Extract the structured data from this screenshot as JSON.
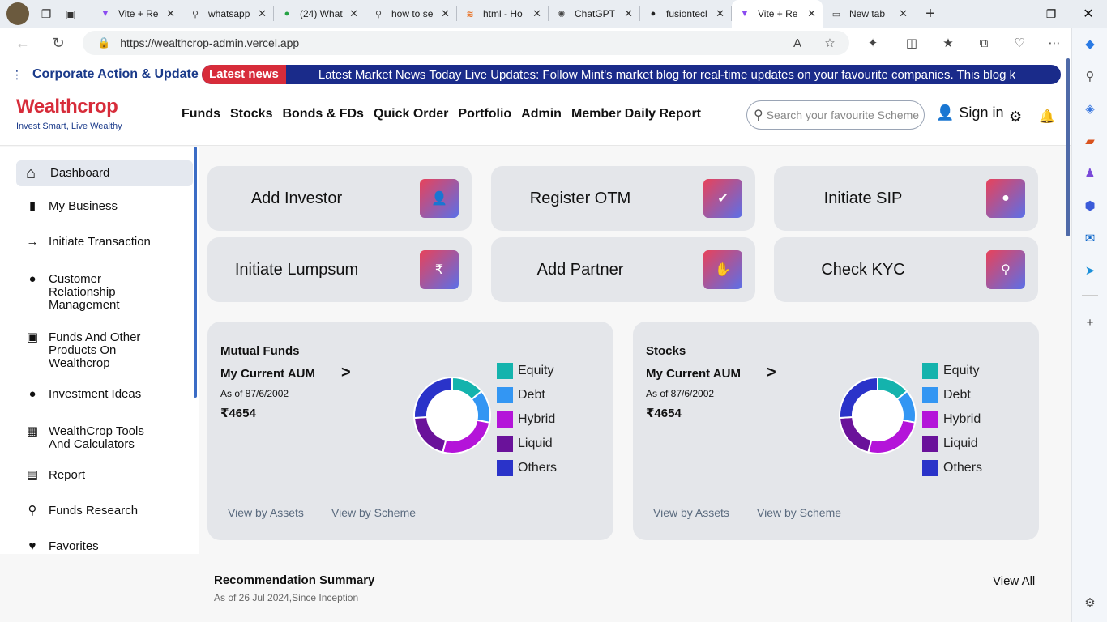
{
  "browser": {
    "tabs": [
      {
        "label": "Vite + Re",
        "icon": "vite-icon"
      },
      {
        "label": "whatsapp",
        "icon": "search-icon"
      },
      {
        "label": "(24) What",
        "icon": "whatsapp-icon"
      },
      {
        "label": "how to se",
        "icon": "search-icon"
      },
      {
        "label": "html - Ho",
        "icon": "stackoverflow-icon"
      },
      {
        "label": "ChatGPT",
        "icon": "chatgpt-icon"
      },
      {
        "label": "fusiontecl",
        "icon": "github-icon"
      },
      {
        "label": "Vite + Re",
        "icon": "vite-icon",
        "active": true
      },
      {
        "label": "New tab",
        "icon": "newtab-icon"
      }
    ],
    "url": "https://wealthcrop-admin.vercel.app"
  },
  "ticker": {
    "title": "Corporate Action & Update",
    "badge": "Latest news",
    "message": "Latest Market News Today Live Updates: Follow Mint's market blog for real-time updates on your favourite companies. This blog k"
  },
  "header": {
    "logo_text": "Wealthcrop",
    "tagline": "Invest Smart, Live Wealthy",
    "menu": [
      "Funds",
      "Stocks",
      "Bonds & FDs",
      "Quick Order",
      "Portfolio",
      "Admin",
      "Member Daily Report"
    ],
    "search_placeholder": "Search your favourite Scheme",
    "signin": "Sign in"
  },
  "sidebar": {
    "items": [
      {
        "label": "Dashboard",
        "icon": "home-icon",
        "active": true
      },
      {
        "label": "My Business",
        "icon": "briefcase-icon"
      },
      {
        "label": "Initiate Transaction",
        "icon": "arrow-right-icon"
      },
      {
        "label": "Customer Relationship Management",
        "icon": "user-icon"
      },
      {
        "label": "Funds And Other Products On Wealthcrop",
        "icon": "wallet-icon"
      },
      {
        "label": "Investment Ideas",
        "icon": "bulb-icon"
      },
      {
        "label": "WealthCrop Tools And Calculators",
        "icon": "calculator-icon"
      },
      {
        "label": "Report",
        "icon": "document-icon"
      },
      {
        "label": "Funds Research",
        "icon": "search-icon"
      },
      {
        "label": "Favorites",
        "icon": "heart-icon"
      }
    ]
  },
  "actions": [
    {
      "label": "Add Investor",
      "icon": "user-plus-icon"
    },
    {
      "label": "Register OTM",
      "icon": "user-check-icon"
    },
    {
      "label": "Initiate SIP",
      "icon": "money-bag-icon"
    },
    {
      "label": "Initiate Lumpsum",
      "icon": "rupee-icon"
    },
    {
      "label": "Add Partner",
      "icon": "handshake-icon"
    },
    {
      "label": "Check KYC",
      "icon": "search-icon"
    }
  ],
  "panels": [
    {
      "title": "Mutual Funds",
      "aum_label": "My Current AUM",
      "arrow": ">",
      "date": "As of 87/6/2002",
      "value": "₹4654",
      "view_assets": "View by Assets",
      "view_scheme": "View by Scheme"
    },
    {
      "title": "Stocks",
      "aum_label": "My Current AUM",
      "arrow": ">",
      "date": "As of 87/6/2002",
      "value": "₹4654",
      "view_assets": "View by Assets",
      "view_scheme": "View by Scheme"
    }
  ],
  "chart_data": {
    "type": "pie",
    "categories": [
      "Equity",
      "Debt",
      "Hybrid",
      "Liquid",
      "Others"
    ],
    "values": [
      14,
      14,
      26,
      20,
      26
    ],
    "colors": [
      "#14b3ad",
      "#3396f3",
      "#b414d9",
      "#6a129a",
      "#2a33c9"
    ]
  },
  "recommendation": {
    "title": "Recommendation Summary",
    "subtitle": "As of 26 Jul 2024,Since Inception",
    "view_all": "View All"
  }
}
